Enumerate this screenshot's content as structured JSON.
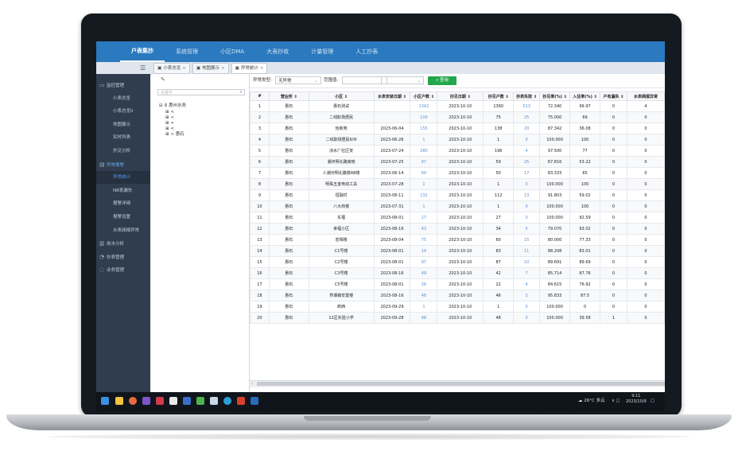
{
  "top_nav": [
    "户表集抄",
    "系统管理",
    "小区DMA",
    "大表抄收",
    "计量管理",
    "人工抄表"
  ],
  "tabs": [
    {
      "label": "小表总览",
      "active": false
    },
    {
      "label": "地图展示",
      "active": false
    },
    {
      "label": "异常统计",
      "active": true
    }
  ],
  "sidebar": [
    {
      "label": "监控管理",
      "type": "group",
      "icon": "monitor-icon"
    },
    {
      "label": "小表总览",
      "type": "sub"
    },
    {
      "label": "小表总览II",
      "type": "sub"
    },
    {
      "label": "地图展示",
      "type": "sub"
    },
    {
      "label": "实时列表",
      "type": "sub"
    },
    {
      "label": "抄见分析",
      "type": "sub"
    },
    {
      "label": "异常报警",
      "type": "group",
      "icon": "alarm-icon",
      "active": true
    },
    {
      "label": "异常统计",
      "type": "sub",
      "active": true
    },
    {
      "label": "NB表漏失",
      "type": "sub"
    },
    {
      "label": "报警详细",
      "type": "sub"
    },
    {
      "label": "报警设置",
      "type": "sub"
    },
    {
      "label": "水表阀报异常",
      "type": "sub"
    },
    {
      "label": "用水分析",
      "type": "group",
      "icon": "chart-icon"
    },
    {
      "label": "抄表管理",
      "type": "group",
      "icon": "reading-icon"
    },
    {
      "label": "业务管理",
      "type": "group",
      "icon": "business-icon"
    }
  ],
  "tree": {
    "search_placeholder": "关键字",
    "root": "惠州水务",
    "selected": "惠石"
  },
  "filter": {
    "type_label": "异常类型:",
    "type_value": "无异常",
    "range_label": "范围值:",
    "range_value": "",
    "query_label": "查询"
  },
  "table": {
    "columns": [
      "#",
      "营业所 ⇕",
      "小区 ⇕",
      "水表安装日期 ⇕",
      "小区户数 ⇕",
      "抄见日期 ⇕",
      "抄见户数 ⇕",
      "抄表失败 ⇕",
      "抄见率(%) ⇕",
      "入住率(%) ⇕",
      "户有漏失 ⇕",
      "水表阀报异常"
    ],
    "rows": [
      [
        "1",
        "惠石",
        "惠石测试",
        "",
        "1342",
        "2023-10-10",
        "1360",
        "523",
        "72.340",
        "99.97",
        "0",
        "4"
      ],
      [
        "2",
        "惠石",
        "二线职场居民",
        "",
        "100",
        "2023-10-10",
        "75",
        "25",
        "75.000",
        "69",
        "0",
        "0"
      ],
      [
        "3",
        "惠石",
        "怡新苑",
        "2023-06-04",
        "155",
        "2023-10-10",
        "138",
        "20",
        "87.342",
        "36.08",
        "0",
        "0"
      ],
      [
        "4",
        "惠石",
        "二线职场居民II/III",
        "2023-06-26",
        "1",
        "2023-10-10",
        "1",
        "0",
        "100.000",
        "100",
        "0",
        "0"
      ],
      [
        "5",
        "惠石",
        "凉水厂社区安",
        "2023-07-24",
        "280",
        "2023-10-10",
        "196",
        "4",
        "97.500",
        "77",
        "0",
        "0"
      ],
      [
        "6",
        "惠石",
        "潮河明北路旁晓",
        "2023-07-25",
        "87",
        "2023-10-10",
        "59",
        "25",
        "67.816",
        "53.22",
        "0",
        "0"
      ],
      [
        "7",
        "惠石",
        "人潮河明北路楼AB楼",
        "2023-06-14",
        "60",
        "2023-10-10",
        "50",
        "17",
        "83.333",
        "65",
        "0",
        "0"
      ],
      [
        "8",
        "惠石",
        "明珠五金电动工具",
        "2023-07-28",
        "1",
        "2023-10-10",
        "1",
        "0",
        "100.000",
        "100",
        "0",
        "0"
      ],
      [
        "9",
        "惠石",
        "恒融村",
        "2023-08-11",
        "132",
        "2023-10-10",
        "112",
        "13",
        "91.803",
        "59.02",
        "0",
        "0"
      ],
      [
        "10",
        "惠石",
        "八大商楼",
        "2023-07-31",
        "1",
        "2023-10-10",
        "1",
        "0",
        "100.000",
        "100",
        "0",
        "0"
      ],
      [
        "11",
        "惠石",
        "东堰",
        "2023-08-01",
        "27",
        "2023-10-10",
        "27",
        "0",
        "100.000",
        "92.59",
        "0",
        "0"
      ],
      [
        "12",
        "惠石",
        "幸福小区",
        "2023-08-16",
        "43",
        "2023-10-10",
        "34",
        "5",
        "79.070",
        "93.02",
        "0",
        "0"
      ],
      [
        "13",
        "惠石",
        "宏辉楼",
        "2023-08-04",
        "75",
        "2023-10-10",
        "60",
        "15",
        "80.000",
        "77.33",
        "0",
        "0"
      ],
      [
        "14",
        "惠石",
        "C1号楼",
        "2023-08-01",
        "14",
        "2023-10-10",
        "83",
        "11",
        "88.208",
        "83.01",
        "0",
        "0"
      ],
      [
        "15",
        "惠石",
        "C2号楼",
        "2023-08-01",
        "97",
        "2023-10-10",
        "87",
        "10",
        "89.691",
        "89.69",
        "0",
        "0"
      ],
      [
        "16",
        "惠石",
        "C3号楼",
        "2023-08-16",
        "49",
        "2023-10-10",
        "42",
        "7",
        "85.714",
        "87.76",
        "0",
        "0"
      ],
      [
        "17",
        "惠石",
        "C5号楼",
        "2023-08-01",
        "26",
        "2023-10-10",
        "22",
        "4",
        "84.615",
        "76.92",
        "0",
        "0"
      ],
      [
        "18",
        "惠石",
        "界潮镇安置楼",
        "2023-08-16",
        "48",
        "2023-10-10",
        "46",
        "2",
        "95.833",
        "87.5",
        "0",
        "0"
      ],
      [
        "19",
        "惠石",
        "新西",
        "2023-09-29",
        "1",
        "2023-10-10",
        "1",
        "0",
        "100.000",
        "0",
        "0",
        "0"
      ],
      [
        "20",
        "惠石",
        "11区实验小学",
        "2023-09-28",
        "48",
        "2023-10-10",
        "48",
        "0",
        "100.000",
        "39.58",
        "1",
        "0"
      ]
    ]
  },
  "taskbar": {
    "weather": "26°C 多云",
    "time": "9:11",
    "date": "2023/10/9"
  }
}
